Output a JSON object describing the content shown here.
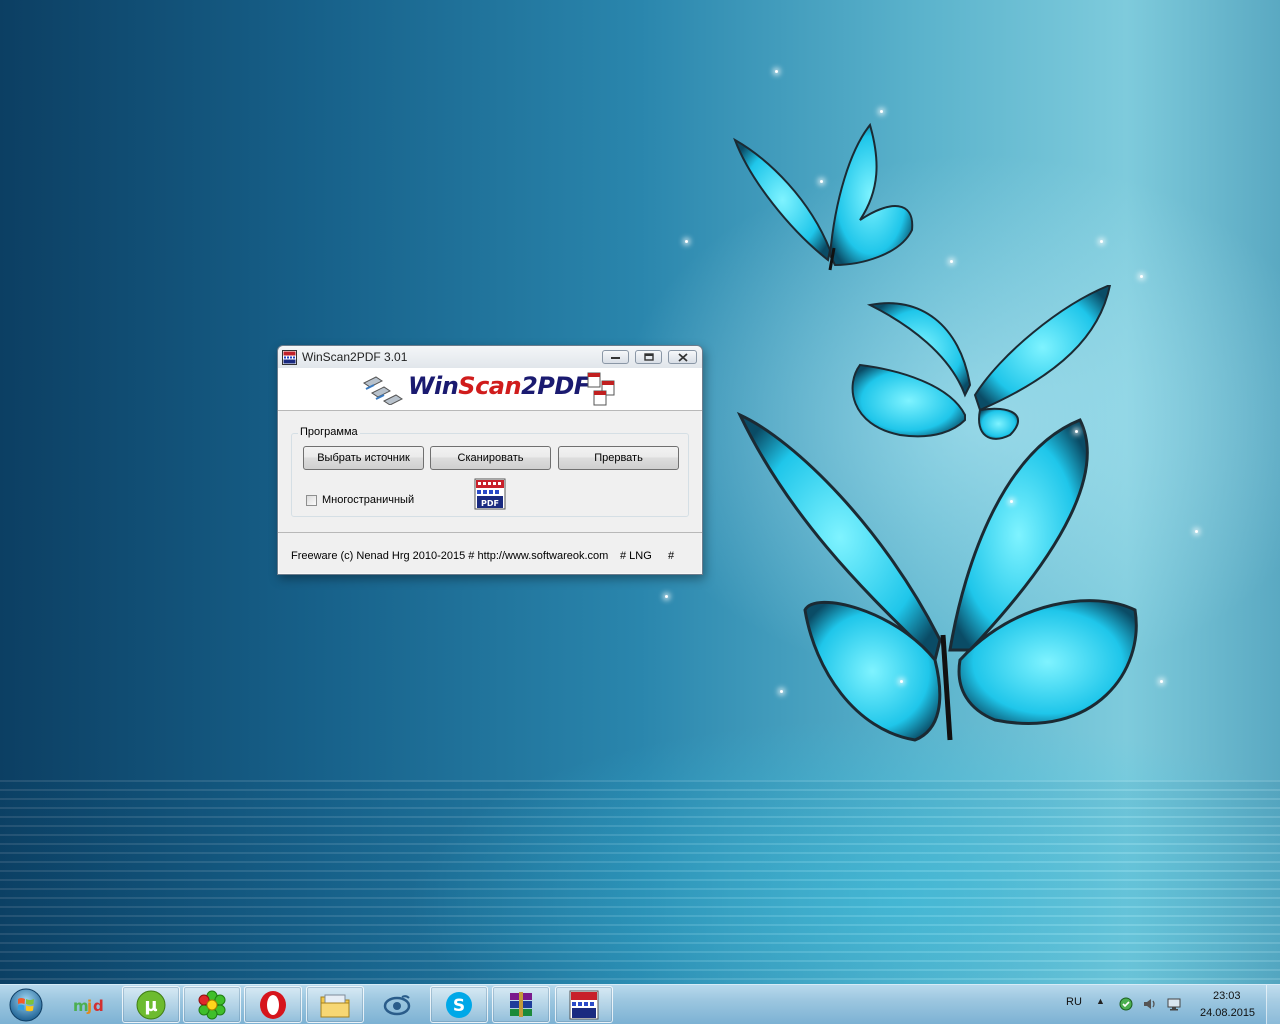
{
  "window": {
    "title": "WinScan2PDF 3.01",
    "logo": {
      "part1": "Win",
      "part2": "Scan",
      "part3": "2PDF"
    },
    "group_label": "Программа",
    "buttons": {
      "select_source": "Выбрать источник",
      "scan": "Сканировать",
      "abort": "Прервать"
    },
    "multipage_label": "Многостраничный",
    "multipage_checked": false,
    "status": {
      "text": "Freeware (c) Nenad Hrg 2010-2015 # http://www.softwareok.com",
      "lng": "# LNG",
      "hash": "#"
    }
  },
  "taskbar": {
    "items": [
      {
        "name": "mjd",
        "icon": "mjd-icon"
      },
      {
        "name": "utorrent",
        "icon": "utorrent-icon"
      },
      {
        "name": "icq",
        "icon": "icq-flower-icon"
      },
      {
        "name": "opera",
        "icon": "opera-icon"
      },
      {
        "name": "explorer",
        "icon": "folder-icon"
      },
      {
        "name": "browser",
        "icon": "eye-icon"
      },
      {
        "name": "skype",
        "icon": "skype-icon"
      },
      {
        "name": "winrar",
        "icon": "winrar-icon"
      },
      {
        "name": "winscan2pdf",
        "icon": "pdf-icon"
      }
    ],
    "tray": {
      "language": "RU",
      "time": "23:03",
      "date": "24.08.2015"
    }
  },
  "colors": {
    "logo_blue": "#1a1a70",
    "logo_red": "#d01c1c"
  }
}
